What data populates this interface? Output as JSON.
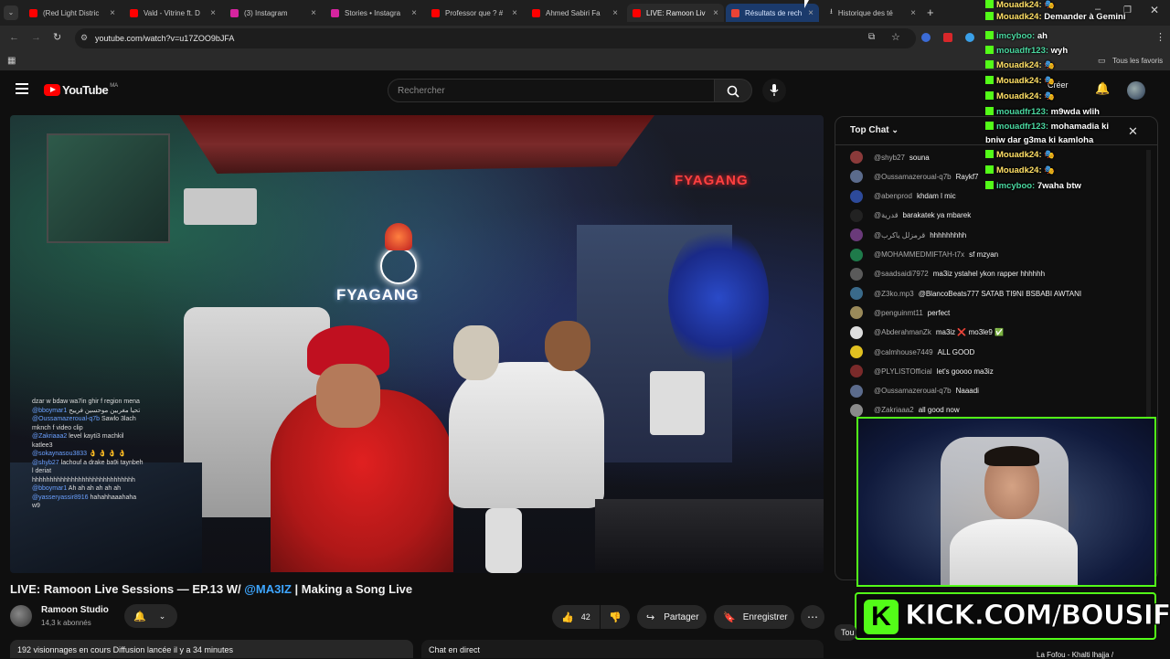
{
  "tabs": [
    {
      "label": "(Red Light Distric",
      "color": "#ff0000"
    },
    {
      "label": "Vald - Vitrine ft. D",
      "color": "#ff0000"
    },
    {
      "label": "(3) Instagram",
      "color": "#d6249f"
    },
    {
      "label": "Stories • Instagra",
      "color": "#d6249f"
    },
    {
      "label": "Professor que ? #",
      "color": "#ff0000"
    },
    {
      "label": "Ahmed Sabiri Fa",
      "color": "#ff0000"
    },
    {
      "label": "LIVE: Ramoon Liv",
      "color": "#ff0000"
    },
    {
      "label": "Résultats de rech",
      "color": "#ea4335"
    },
    {
      "label": "Historique des té",
      "color": "#aaaaaa"
    }
  ],
  "address": {
    "url": "youtube.com/watch?v=u17ZOO9bJFA"
  },
  "bookmarks": {
    "all_label": "Tous les favoris"
  },
  "youtube": {
    "logo": "YouTube",
    "region": "MA",
    "search_placeholder": "Rechercher",
    "create_label": "Créer"
  },
  "video": {
    "sign_left": "FYAGANG",
    "sign_right": "FYAGANG",
    "overlay_chat": [
      {
        "user": "",
        "text": "dzar w bdaw wa7in ghir f region mena"
      },
      {
        "user": "@bboymar1",
        "text": "تحيا مغربين موحسين فرييح"
      },
      {
        "user": "@Oussamazeroual-q7b",
        "text": "Sawlo 3lach"
      },
      {
        "user": "",
        "text": "mknch f video clip"
      },
      {
        "user": "@Zakriaaa2",
        "text": "level kayti3 machkil"
      },
      {
        "user": "",
        "text": "katlee3"
      },
      {
        "user": "@sokaynasou3833",
        "text": "👌 👌 👌 👌"
      },
      {
        "user": "@shyb27",
        "text": "lachouf a drake ba9i taynbeh"
      },
      {
        "user": "",
        "text": "l deriat"
      },
      {
        "user": "",
        "text": "hhhhhhhhhhhhhhhhhhhhhhhhhhhhh"
      },
      {
        "user": "@bboymar1",
        "text": "Ah ah ah ah ah ah"
      },
      {
        "user": "@yasseryassir8916",
        "text": "hahahhaaahaha"
      },
      {
        "user": "",
        "text": "w9"
      }
    ]
  },
  "title": {
    "main": "LIVE: Ramoon Live Sessions — EP.13 W/ ",
    "tag": "@MA3IZ",
    "rest": " | Making a Song Live"
  },
  "channel": {
    "name": "Ramoon Studio",
    "subs": "14,3 k abonnés"
  },
  "actions": {
    "likes": "42",
    "share": "Partager",
    "save": "Enregistrer"
  },
  "meta": {
    "line": "192 visionnages en cours  Diffusion lancée il y a 34 minutes"
  },
  "chat_label": "Chat en direct",
  "chat": {
    "header": "Top Chat",
    "messages": [
      {
        "user": "@shyb27",
        "text": "souna",
        "color": "#8b3a3a"
      },
      {
        "user": "@Oussamazeroual-q7b",
        "text": "Raykf7",
        "color": "#5b6b8c"
      },
      {
        "user": "@abenprod",
        "text": "khdam l mic",
        "color": "#2d4a9a"
      },
      {
        "user": "@قدرية",
        "text": "barakatek ya mbarek",
        "color": "#222222"
      },
      {
        "user": "@قرمزلل ياكرب",
        "text": "hhhhhhhhh",
        "color": "#6a3a7a"
      },
      {
        "user": "@MOHAMMEDMIFTAH-t7x",
        "text": "sf mzyan",
        "color": "#1e7a4a"
      },
      {
        "user": "@saadsaidi7972",
        "text": "ma3iz ystahel ykon rapper hhhhhh",
        "color": "#5a5a5a"
      },
      {
        "user": "@Z3ko.mp3",
        "text": "@BlancoBeats777 SATAB TI9NI BSBABI AWTANI",
        "color": "#3a6a8a"
      },
      {
        "user": "@penguinmt11",
        "text": "perfect",
        "color": "#9a8a5a"
      },
      {
        "user": "@AbderahmanZk",
        "text": "ma3iz ❌ mo3le9 ✅",
        "color": "#dddddd"
      },
      {
        "user": "@calmhouse7449",
        "text": "ALL GOOD",
        "color": "#e0c020"
      },
      {
        "user": "@PLYLISTOfficial",
        "text": "let's goooo ma3iz",
        "color": "#7a2a2a"
      },
      {
        "user": "@Oussamazeroual-q7b",
        "text": "Naaadi",
        "color": "#5b6b8c"
      },
      {
        "user": "@Zakriaaa2",
        "text": "all good now",
        "color": "#8a8a8a"
      }
    ]
  },
  "kick_chat": [
    {
      "user": "Mouadk24:",
      "text": "🎭",
      "style": "user"
    },
    {
      "user": "Mouadk24:",
      "text": "Demander à Gemini",
      "style": "user"
    },
    {
      "user": "imcyboo:",
      "text": "ah",
      "style": "user2"
    },
    {
      "user": "mouadfr123:",
      "text": "wyh",
      "style": "user2"
    },
    {
      "user": "Mouadk24:",
      "text": "🎭",
      "style": "user"
    },
    {
      "user": "Mouadk24:",
      "text": "🎭",
      "style": "user"
    },
    {
      "user": "Mouadk24:",
      "text": "🎭",
      "style": "user"
    },
    {
      "user": "mouadfr123:",
      "text": "m9wda wlih",
      "style": "user2"
    },
    {
      "user": "mouadfr123:",
      "text": "mohamadia ki",
      "style": "user2"
    },
    {
      "user": "",
      "text": "bniw dar g3ma ki kamloha",
      "style": "txt"
    },
    {
      "user": "Mouadk24:",
      "text": "🎭",
      "style": "user"
    },
    {
      "user": "Mouadk24:",
      "text": "🎭",
      "style": "user"
    },
    {
      "user": "imcyboo:",
      "text": "7waha btw",
      "style": "user2"
    }
  ],
  "kick_banner": "KICK.COM/BOUSIF",
  "bottom": {
    "tab_label": "Tou",
    "next_video": "La Fofou - Khalti lhajja /"
  }
}
